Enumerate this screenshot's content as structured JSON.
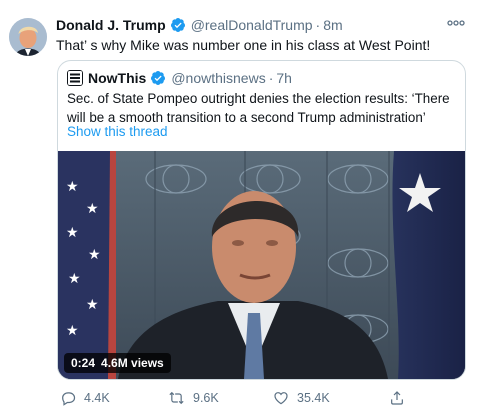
{
  "tweet": {
    "author_name": "Donald J. Trump",
    "author_handle": "@realDonaldTrump",
    "separator": "·",
    "time": "8m",
    "text": "That’ s why Mike was number one in his class at West Point!",
    "more_icon": "more-horizontal-icon",
    "verified_icon": "verified-badge-icon",
    "accent_color": "#1d9bf0"
  },
  "quote": {
    "author_name": "NowThis",
    "author_handle": "@nowthisnews",
    "separator": "·",
    "time": "7h",
    "text": "Sec. of State Pompeo outright denies the election results: ‘There will be a smooth transition to a second Trump administration’",
    "show_thread": "Show this thread",
    "video": {
      "duration": "0:24",
      "views": "4.6M views"
    }
  },
  "actions": {
    "reply": {
      "icon": "reply-icon",
      "count": "4.4K"
    },
    "retweet": {
      "icon": "retweet-icon",
      "count": "9.6K"
    },
    "like": {
      "icon": "heart-icon",
      "count": "35.4K"
    },
    "share": {
      "icon": "share-icon"
    }
  }
}
